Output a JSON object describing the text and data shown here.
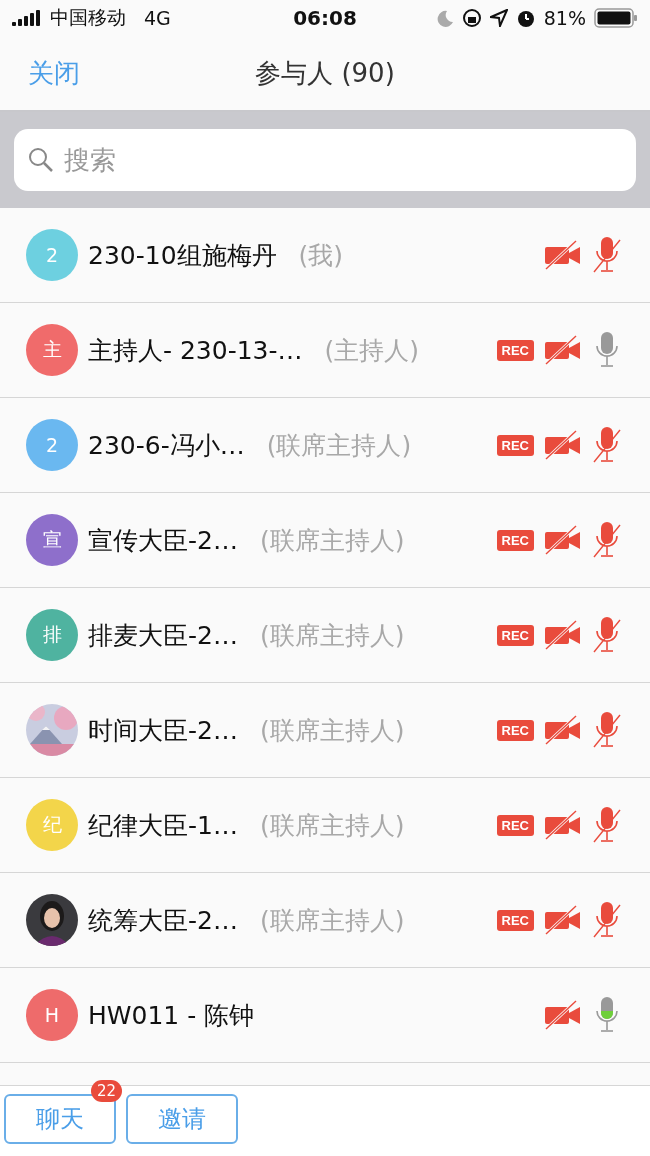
{
  "status_bar": {
    "carrier": "中国移动",
    "network": "4G",
    "time": "06:08",
    "battery": "81%"
  },
  "nav": {
    "close": "关闭",
    "title": "参与人 (90)"
  },
  "search": {
    "placeholder": "搜索"
  },
  "participants": [
    {
      "avatar": {
        "kind": "letter",
        "text": "2",
        "color": "#6dd0e0"
      },
      "name": "230-10组施梅丹",
      "role": "(我)",
      "mic_muted": true,
      "speaking": false
    },
    {
      "avatar": {
        "kind": "letter",
        "text": "主",
        "color": "#f06b6b"
      },
      "name": "主持人- 230-13-…",
      "role": "(主持人)",
      "rec": "REC",
      "mic_muted": false,
      "speaking": false
    },
    {
      "avatar": {
        "kind": "letter",
        "text": "2",
        "color": "#6ab8f0"
      },
      "name": "230-6-冯小…",
      "role": "(联席主持人)",
      "rec": "REC",
      "mic_muted": true,
      "speaking": false
    },
    {
      "avatar": {
        "kind": "letter",
        "text": "宣",
        "color": "#8e6fcb"
      },
      "name": "宣传大臣-2…",
      "role": "(联席主持人)",
      "rec": "REC",
      "mic_muted": true,
      "speaking": false
    },
    {
      "avatar": {
        "kind": "letter",
        "text": "排",
        "color": "#4fb3a0"
      },
      "name": "排麦大臣-2…",
      "role": "(联席主持人)",
      "rec": "REC",
      "mic_muted": true,
      "speaking": false
    },
    {
      "name": "时间大臣-2…",
      "role": "(联席主持人)",
      "rec": "REC",
      "mic_muted": true,
      "speaking": false
    },
    {
      "avatar": {
        "kind": "letter",
        "text": "纪",
        "color": "#f3d54a"
      },
      "name": "纪律大臣-1…",
      "role": "(联席主持人)",
      "rec": "REC",
      "mic_muted": true,
      "speaking": false
    },
    {
      "name": "统筹大臣-2…",
      "role": "(联席主持人)",
      "rec": "REC",
      "mic_muted": true,
      "speaking": false
    },
    {
      "avatar": {
        "kind": "letter",
        "text": "H",
        "color": "#ee6b6b"
      },
      "name": "HW011 - 陈钟",
      "mic_muted": false,
      "speaking": true
    }
  ],
  "buttons": [
    {
      "label": "聊天",
      "badge": "22"
    },
    {
      "label": "邀请"
    }
  ]
}
